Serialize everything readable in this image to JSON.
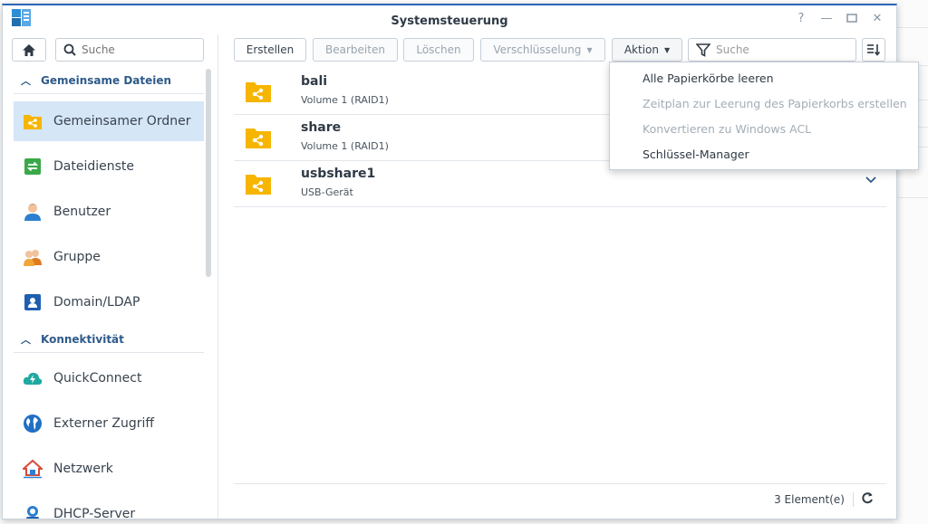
{
  "window": {
    "title": "Systemsteuerung"
  },
  "sidebar": {
    "search_placeholder": "Suche",
    "sections": [
      {
        "label": "Gemeinsame Dateien"
      },
      {
        "label": "Konnektivität"
      }
    ],
    "items": [
      {
        "label": "Gemeinsamer Ordner"
      },
      {
        "label": "Dateidienste"
      },
      {
        "label": "Benutzer"
      },
      {
        "label": "Gruppe"
      },
      {
        "label": "Domain/LDAP"
      },
      {
        "label": "QuickConnect"
      },
      {
        "label": "Externer Zugriff"
      },
      {
        "label": "Netzwerk"
      },
      {
        "label": "DHCP-Server"
      }
    ]
  },
  "toolbar": {
    "create": "Erstellen",
    "edit": "Bearbeiten",
    "delete": "Löschen",
    "encryption": "Verschlüsselung",
    "action": "Aktion",
    "search_placeholder": "Suche"
  },
  "shares": [
    {
      "name": "bali",
      "location": "Volume 1 (RAID1)"
    },
    {
      "name": "share",
      "location": "Volume 1 (RAID1)"
    },
    {
      "name": "usbshare1",
      "location": "USB-Gerät"
    }
  ],
  "footer": {
    "count": "3 Element(e)"
  },
  "action_menu": {
    "items": [
      {
        "label": "Alle Papierkörbe leeren",
        "enabled": true
      },
      {
        "label": "Zeitplan zur Leerung des Papierkorbs erstellen",
        "enabled": false
      },
      {
        "label": "Konvertieren zu Windows ACL",
        "enabled": false
      },
      {
        "label": "Schlüssel-Manager",
        "enabled": true
      }
    ]
  },
  "colors": {
    "accent": "#2c64b8",
    "folder": "#f6b500",
    "active_bg": "#d5e6f7",
    "section_text": "#2e5a8a"
  }
}
